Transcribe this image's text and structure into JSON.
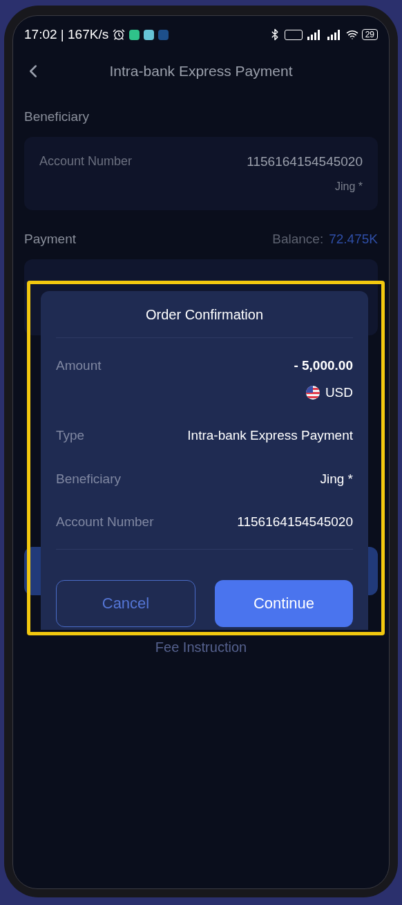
{
  "status_bar": {
    "time_and_speed": "17:02 | 167K/s",
    "battery": "29"
  },
  "header": {
    "title": "Intra-bank Express Payment"
  },
  "beneficiary": {
    "label": "Beneficiary",
    "field_label": "Account Number",
    "account_number": "1156164154545020",
    "name": "Jing *"
  },
  "payment": {
    "label": "Payment",
    "balance_label": "Balance:",
    "balance": "72.475K"
  },
  "fee_link": "Fee Instruction",
  "dialog": {
    "title": "Order Confirmation",
    "rows": [
      {
        "label": "Amount",
        "value": "- 5,000.00",
        "currency": "USD"
      },
      {
        "label": "Type",
        "value": "Intra-bank Express Payment"
      },
      {
        "label": "Beneficiary",
        "value": "Jing *"
      },
      {
        "label": "Account Number",
        "value": "1156164154545020"
      }
    ],
    "buttons": [
      {
        "label": "Cancel",
        "kind": "secondary"
      },
      {
        "label": "Continue",
        "kind": "primary"
      }
    ]
  }
}
